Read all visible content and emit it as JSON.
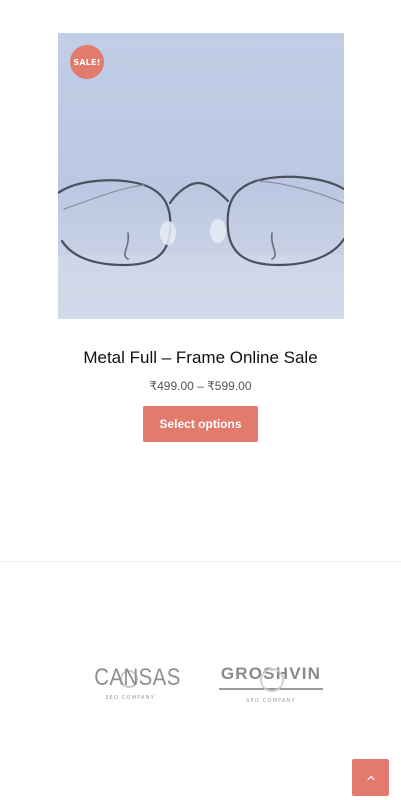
{
  "product": {
    "sale_badge": "SALE!",
    "title": "Metal Full – Frame Online Sale",
    "price_range": "₹499.00 – ₹599.00",
    "select_options_label": "Select options",
    "image_icon": "eyeglasses-photo"
  },
  "partners": {
    "logos": [
      {
        "name": "CANSAS",
        "tagline": "SEO COMPANY"
      },
      {
        "name": "GROSHVIN",
        "tagline": "SEO COMPANY"
      }
    ]
  },
  "back_to_top": {
    "icon": "chevron-up-icon"
  },
  "colors": {
    "accent": "#e27a6d",
    "image_bg": "#c2cde6",
    "divider": "#eeeeee",
    "logo_gray": "#8a8a8a"
  }
}
